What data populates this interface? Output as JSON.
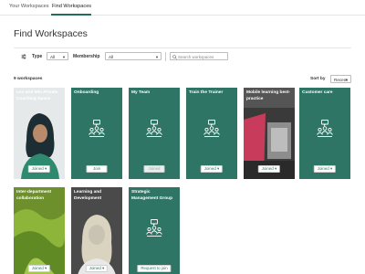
{
  "tabs": [
    {
      "label": "Your Workspaces"
    },
    {
      "label": "Find Workspaces"
    }
  ],
  "page_title": "Find Workspaces",
  "filters": {
    "type_label": "Type",
    "type_value": "All",
    "membership_label": "Membership",
    "membership_value": "All",
    "search_placeholder": "Search workspaces"
  },
  "results": {
    "count_text": "9 workspaces",
    "sort_label": "Sort by",
    "sort_value": "Recent"
  },
  "cards": [
    {
      "title": "Leo and Min Private Coaching Space",
      "button": "Joined",
      "dropdown": true
    },
    {
      "title": "Onboarding",
      "button": "Join"
    },
    {
      "title": "My Team",
      "button": "Joined"
    },
    {
      "title": "Train the Trainer",
      "button": "Joined",
      "dropdown": true
    },
    {
      "title": "Mobile learning best-practice",
      "button": "Joined",
      "dropdown": true
    },
    {
      "title": "Customer care",
      "button": "Joined",
      "dropdown": true
    },
    {
      "title": "Inter-department collaboration",
      "button": "Joined",
      "dropdown": true
    },
    {
      "title": "Learning and Development",
      "button": "Joined",
      "dropdown": true
    },
    {
      "title": "Strategic Management Group",
      "button": "Request to join"
    }
  ],
  "colors": {
    "card_green": "#2f7565",
    "accent": "#1f6e5c"
  },
  "icons": {
    "filter": "sliders-icon",
    "search": "search-icon",
    "group": "people-chat-icon",
    "caret": "caret-down-icon"
  }
}
